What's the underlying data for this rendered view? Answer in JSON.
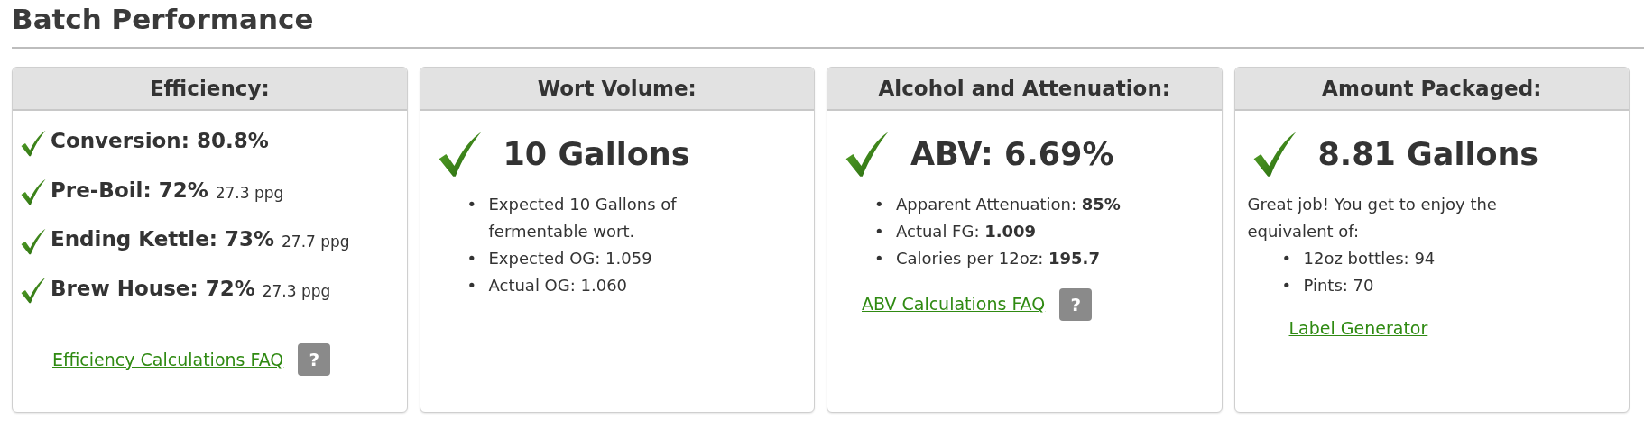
{
  "page_title": "Batch Performance",
  "cards": [
    {
      "kind": "checklist",
      "title": "Efficiency:",
      "checks": [
        {
          "label": "Conversion: 80.8%"
        },
        {
          "label": "Pre-Boil: 72%",
          "detail": "27.3 ppg"
        },
        {
          "label": "Ending Kettle: 73%",
          "detail": "27.7 ppg"
        },
        {
          "label": "Brew House: 72%",
          "detail": "27.3 ppg"
        }
      ],
      "link": "Efficiency Calculations FAQ",
      "help": "?"
    },
    {
      "kind": "summary",
      "title": "Wort Volume:",
      "headline": "10 Gallons",
      "bullets": [
        {
          "marker": "•",
          "text": "Expected 10 Gallons of fermentable wort."
        },
        {
          "marker": "•",
          "text": "Expected OG: 1.059"
        },
        {
          "marker": "•",
          "text": "Actual OG: 1.060"
        }
      ]
    },
    {
      "kind": "summary",
      "title": "Alcohol and Attenuation:",
      "headline": "ABV: 6.69%",
      "bullets": [
        {
          "marker": "•",
          "text": "Apparent Attenuation: **85%**"
        },
        {
          "marker": "•",
          "text": "Actual FG: **1.009**"
        },
        {
          "marker": "•",
          "text": "Calories per 12oz: **195.7**"
        }
      ],
      "link": "ABV Calculations FAQ",
      "help": "?"
    },
    {
      "kind": "summary",
      "title": "Amount Packaged:",
      "headline": "8.81 Gallons",
      "note": "Great job! You get to enjoy the equivalent of:",
      "bullets": [
        {
          "marker": "•",
          "text": "12oz bottles: 94"
        },
        {
          "marker": "•",
          "text": "Pints: 70"
        }
      ],
      "link": "Label Generator"
    }
  ]
}
